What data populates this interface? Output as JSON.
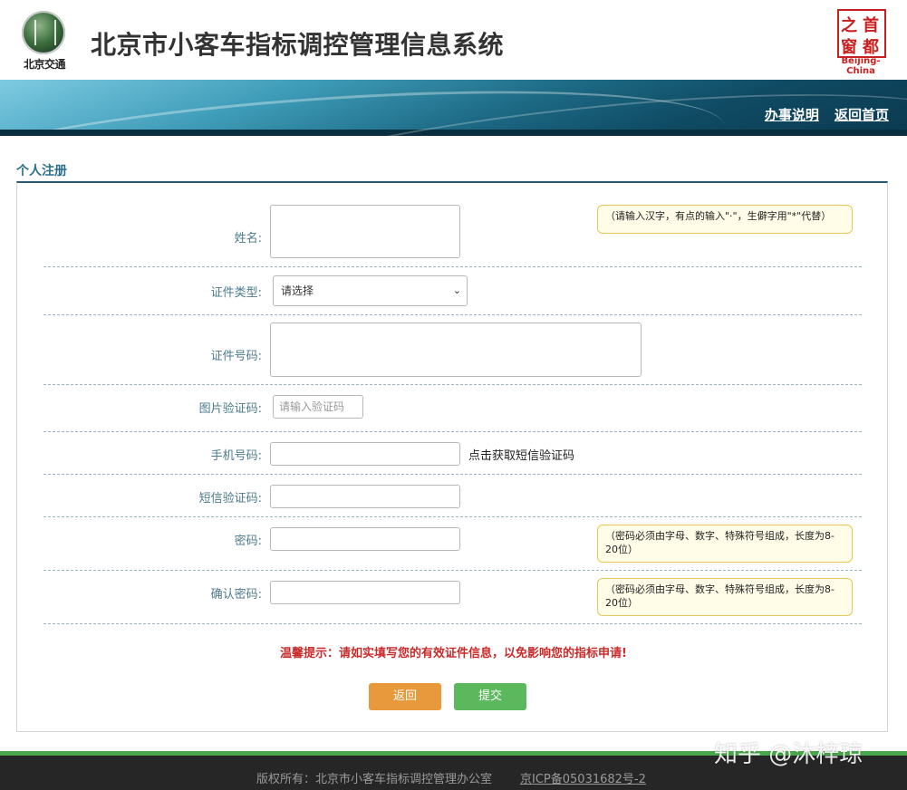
{
  "header": {
    "logo_text": "北京交通",
    "title": "北京市小客车指标调控管理信息系统",
    "brand_chars": [
      "之",
      "首",
      "窗",
      "都"
    ],
    "brand_en": "Beijing-China"
  },
  "banner": {
    "links": [
      "办事说明",
      "返回首页"
    ]
  },
  "section": {
    "title": "个人注册"
  },
  "form": {
    "name_label": "姓名:",
    "name_hint": "（请输入汉字，有点的输入\"·\"，生僻字用\"*\"代替）",
    "id_type_label": "证件类型:",
    "id_type_value": "请选择",
    "id_number_label": "证件号码:",
    "captcha_label": "图片验证码:",
    "captcha_placeholder": "请输入验证码",
    "phone_label": "手机号码:",
    "sms_link": "点击获取短信验证码",
    "sms_code_label": "短信验证码:",
    "password_label": "密码:",
    "password_hint": "（密码必须由字母、数字、特殊符号组成，长度为8-20位）",
    "confirm_label": "确认密码:",
    "confirm_hint": "（密码必须由字母、数字、特殊符号组成，长度为8-20位）"
  },
  "warning": "温馨提示：请如实填写您的有效证件信息，以免影响您的指标申请!",
  "buttons": {
    "back": "返回",
    "submit": "提交"
  },
  "footer": {
    "copyright": "版权所有：北京市小客车指标调控管理办公室",
    "icp": "京ICP备05031682号-2"
  },
  "watermark": "知乎 @沐梓琼",
  "colors": {
    "accent": "#2a6f8a",
    "warning": "#c92a2a",
    "back_button": "#e8993c",
    "submit_button": "#5cb85c",
    "footer_bar": "#4aa84c"
  }
}
